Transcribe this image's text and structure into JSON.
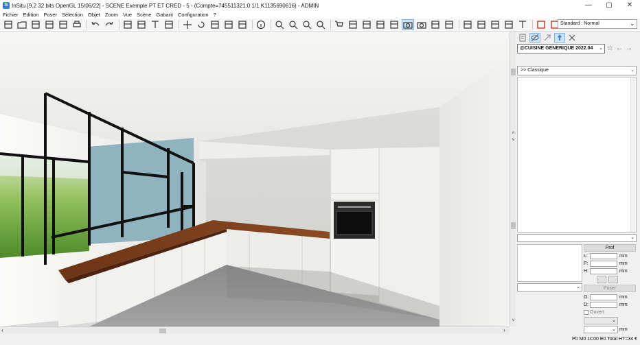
{
  "window": {
    "icon_letter": "S",
    "title": "InSitu [9.2 32 bits OpenGL 15/06/22] - SCENE Exemple PT ET CRED - 5 - (Compte=745511321:0 1/1 K1135690616) - ADMIN",
    "controls": [
      "—",
      "▢",
      "✕"
    ]
  },
  "menu": [
    "Fichier",
    "Edition",
    "Poser",
    "Sélection",
    "Objet",
    "Zoom",
    "Vue",
    "Scène",
    "Gabarit",
    "Configuration",
    "?"
  ],
  "toolbar": {
    "groups": [
      [
        "new-file-icon",
        "open-folder-icon",
        "save-icon",
        "save-as-icon",
        "book-icon",
        "print-icon"
      ],
      [
        "undo-icon",
        "redo-icon"
      ],
      [
        "measure-icon",
        "dimension-icon",
        "text-icon",
        "arrow-line-icon"
      ],
      [
        "move-icon",
        "rotate-icon",
        "place-floor-icon",
        "place-wall-icon",
        "place-ceiling-icon"
      ],
      [
        "info-icon"
      ],
      [
        "zoom-in-icon",
        "zoom-out-icon",
        "zoom-fit-icon",
        "zoom-window-icon"
      ],
      [
        "cart-icon",
        "plan-icon",
        "elevation-icon",
        "layout-icon",
        "3d-box-icon",
        "camera-icon",
        "photo-icon",
        "render-icon",
        "walk-icon"
      ],
      [
        "tree-icon",
        "light-icon",
        "ruler-icon",
        "crop-icon",
        "texture-icon"
      ],
      [
        "frame-icon",
        "settings-frame-icon"
      ]
    ],
    "active_tool": "camera-icon",
    "mode_select": {
      "value": "Standard : Normal"
    }
  },
  "panel": {
    "tools": [
      "properties-icon",
      "hide-icon",
      "arrow-icon",
      "pin-icon",
      "close-icon"
    ],
    "active_tools": [
      "hide-icon",
      "pin-icon"
    ],
    "catalog_select": "@CUISINE GENERIQUE 2022.04",
    "type_select": ">> Classique",
    "prof_label": "Prof",
    "dims": [
      {
        "label": "L:",
        "unit": "mm"
      },
      {
        "label": "P:",
        "unit": "mm"
      },
      {
        "label": "H:",
        "unit": "mm"
      }
    ],
    "poser_label": "Poser",
    "offsets": [
      {
        "label": "G:",
        "unit": "mm"
      },
      {
        "label": "D:",
        "unit": "mm"
      }
    ],
    "ouvert_label": "Ouvert",
    "bottom_unit": "mm"
  },
  "colors": {
    "walnut_worktop": "#7a3f1d",
    "blue_wall": "#8fb3bf",
    "black_frame": "#111111",
    "white_cabinet": "#ededeb",
    "floor": "#8f8f8f",
    "active_tool_bg": "#cce4f7"
  },
  "status": "P0 M0 1C00 E0 Total HT=34 €"
}
